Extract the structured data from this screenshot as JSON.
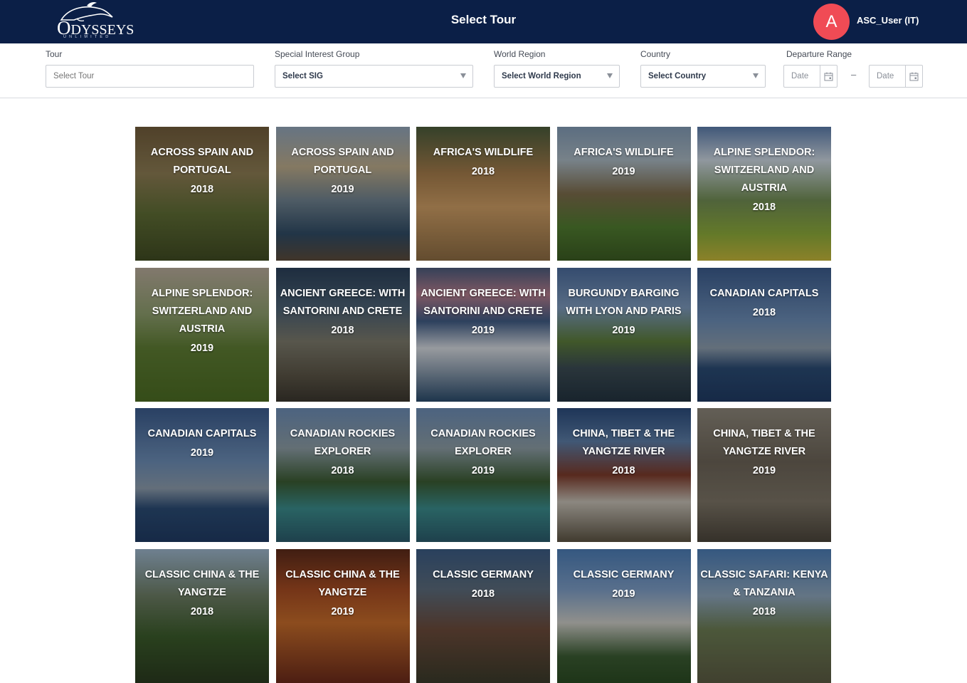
{
  "header": {
    "logo_text": "ODYSSEYS",
    "logo_sub": "UNLIMITED",
    "title": "Select Tour",
    "avatar_initial": "A",
    "username": "ASC_User (IT)",
    "bg_color": "#0b1f47",
    "avatar_color": "#f04b55"
  },
  "filters": {
    "tour": {
      "label": "Tour",
      "placeholder": "Select Tour"
    },
    "sig": {
      "label": "Special Interest Group",
      "value": "Select SIG"
    },
    "region": {
      "label": "World Region",
      "value": "Select World Region"
    },
    "country": {
      "label": "Country",
      "value": "Select Country"
    },
    "departure": {
      "label": "Departure Range",
      "from_placeholder": "Date",
      "to_placeholder": "Date",
      "separator": "–"
    }
  },
  "tours": [
    {
      "name": "ACROSS SPAIN AND PORTUGAL",
      "year": "2018",
      "icon": "landscape-park"
    },
    {
      "name": "ACROSS SPAIN AND PORTUGAL",
      "year": "2019",
      "icon": "harbor-boats"
    },
    {
      "name": "AFRICA'S WILDLIFE",
      "year": "2018",
      "icon": "lion-cubs"
    },
    {
      "name": "AFRICA'S WILDLIFE",
      "year": "2019",
      "icon": "giraffes"
    },
    {
      "name": "ALPINE SPLENDOR: SWITZERLAND AND AUSTRIA",
      "year": "2018",
      "icon": "alpine-meadow"
    },
    {
      "name": "ALPINE SPLENDOR: SWITZERLAND AND AUSTRIA",
      "year": "2019",
      "icon": "alpine-valley"
    },
    {
      "name": "ANCIENT GREECE: WITH SANTORINI AND CRETE",
      "year": "2018",
      "icon": "ruins"
    },
    {
      "name": "ANCIENT GREECE: WITH SANTORINI AND CRETE",
      "year": "2019",
      "icon": "santorini"
    },
    {
      "name": "BURGUNDY BARGING WITH LYON AND PARIS",
      "year": "2019",
      "icon": "barge"
    },
    {
      "name": "CANADIAN CAPITALS",
      "year": "2018",
      "icon": "city-skyline"
    },
    {
      "name": "CANADIAN CAPITALS",
      "year": "2019",
      "icon": "city-skyline"
    },
    {
      "name": "CANADIAN ROCKIES EXPLORER",
      "year": "2018",
      "icon": "mountain-lake"
    },
    {
      "name": "CANADIAN ROCKIES EXPLORER",
      "year": "2019",
      "icon": "mountain-lake"
    },
    {
      "name": "CHINA, TIBET & THE YANGTZE RIVER",
      "year": "2018",
      "icon": "palace"
    },
    {
      "name": "CHINA, TIBET & THE YANGTZE RIVER",
      "year": "2019",
      "icon": "terracotta"
    },
    {
      "name": "CLASSIC CHINA & THE YANGTZE",
      "year": "2018",
      "icon": "great-wall"
    },
    {
      "name": "CLASSIC CHINA & THE YANGTZE",
      "year": "2019",
      "icon": "temple-roof"
    },
    {
      "name": "CLASSIC GERMANY",
      "year": "2018",
      "icon": "castle-town"
    },
    {
      "name": "CLASSIC GERMANY",
      "year": "2019",
      "icon": "castle"
    },
    {
      "name": "CLASSIC SAFARI: KENYA & TANZANIA",
      "year": "2018",
      "icon": "elephants"
    }
  ]
}
